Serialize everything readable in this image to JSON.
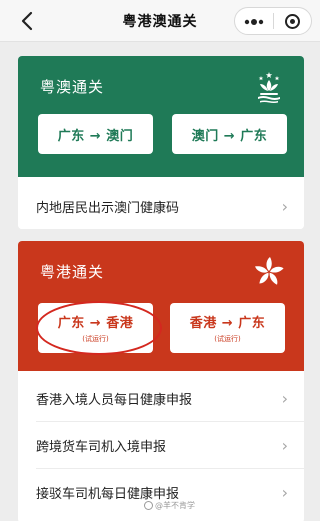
{
  "nav": {
    "back_icon": "chevron-left-icon",
    "title": "粤港澳通关",
    "more_icon": "more-dots-icon",
    "close_icon": "mini-program-close-icon"
  },
  "macau_card": {
    "title": "粤澳通关",
    "color": "#1f7a57",
    "emblem_icon": "macau-lotus-emblem-icon",
    "routes": [
      {
        "label": "广东 → 澳门"
      },
      {
        "label": "澳门 → 广东"
      }
    ],
    "items": [
      {
        "label": "内地居民出示澳门健康码"
      }
    ]
  },
  "hk_card": {
    "title": "粤港通关",
    "color": "#c9371c",
    "emblem_icon": "hk-bauhinia-emblem-icon",
    "routes": [
      {
        "label": "广东 → 香港",
        "note": "(试运行)"
      },
      {
        "label": "香港 → 广东",
        "note": "(试运行)"
      }
    ],
    "items": [
      {
        "label": "香港入境人员每日健康申报"
      },
      {
        "label": "跨境货车司机入境申报"
      },
      {
        "label": "接驳车司机每日健康申报"
      }
    ]
  },
  "chevron": "›",
  "watermark": "@羊不肯学"
}
